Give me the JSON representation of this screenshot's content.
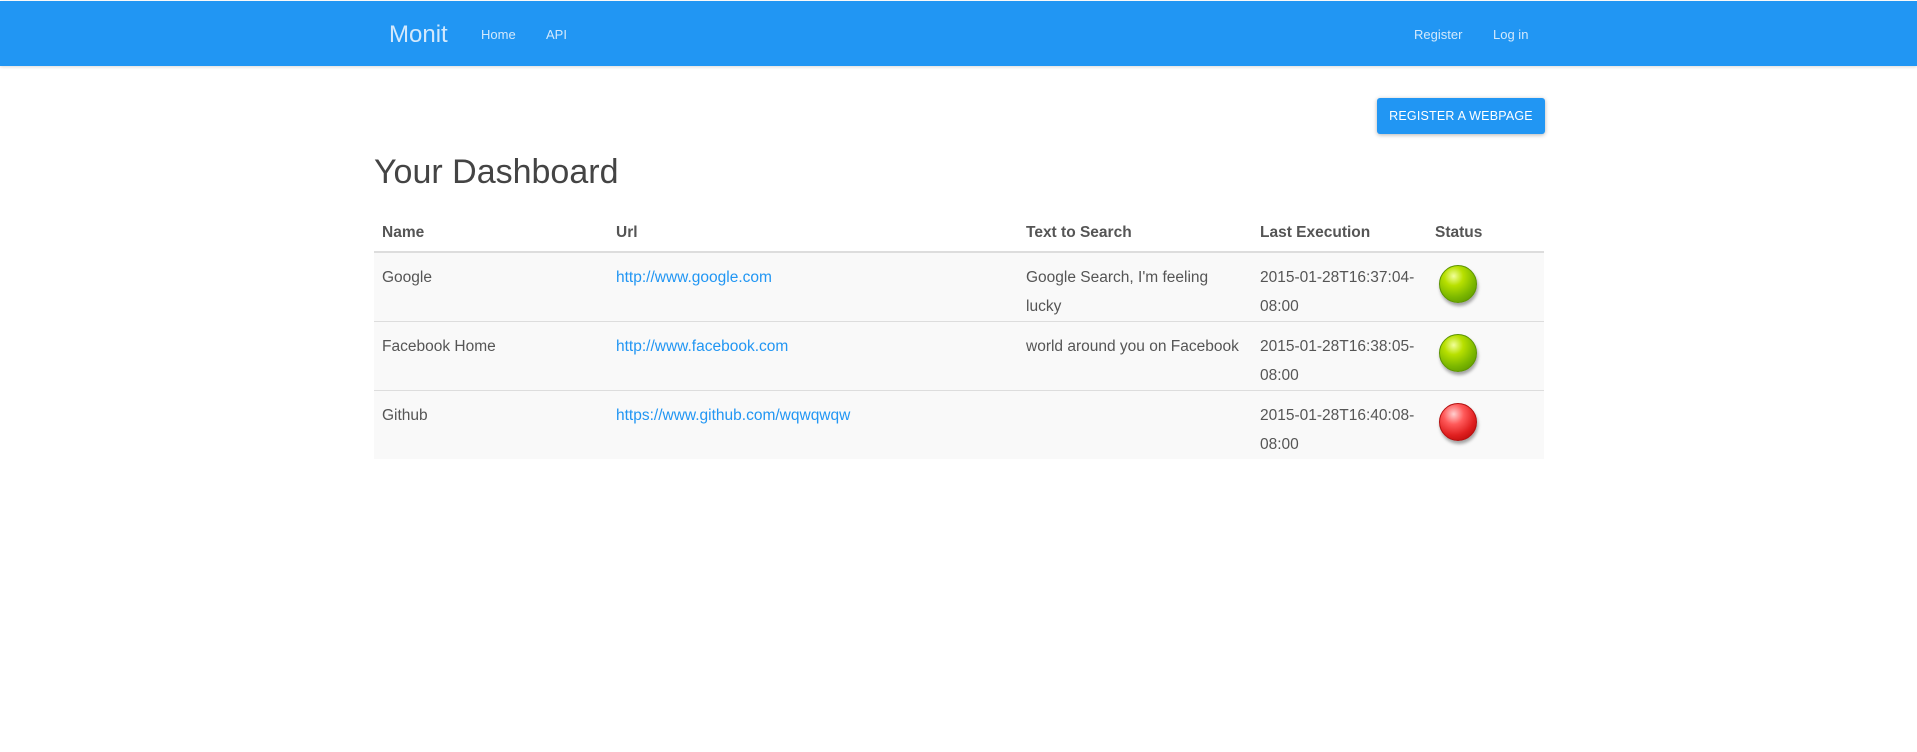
{
  "navbar": {
    "brand": "Monit",
    "links": [
      {
        "label": "Home"
      },
      {
        "label": "API"
      }
    ],
    "right_links": [
      {
        "label": "Register"
      },
      {
        "label": "Log in"
      }
    ],
    "background": "#2196f3"
  },
  "actions": {
    "register_label": "REGISTER A WEBPAGE"
  },
  "page": {
    "title": "Your Dashboard"
  },
  "table": {
    "headers": [
      "Name",
      "Url",
      "Text to Search",
      "Last Execution",
      "Status"
    ],
    "rows": [
      {
        "name": "Google",
        "url": "http://www.google.com",
        "text": "Google Search, I'm feeling lucky",
        "last": "2015-01-28T16:37:04-08:00",
        "status": "ok",
        "status_icon": "green-status-icon"
      },
      {
        "name": "Facebook Home",
        "url": "http://www.facebook.com",
        "text": "world around you on Facebook",
        "last": "2015-01-28T16:38:05-08:00",
        "status": "ok",
        "status_icon": "green-status-icon"
      },
      {
        "name": "Github",
        "url": "https://www.github.com/wqwqwqw",
        "text": "",
        "last": "2015-01-28T16:40:08-08:00",
        "status": "fail",
        "status_icon": "red-status-icon"
      }
    ]
  },
  "colors": {
    "accent": "#2196f3",
    "link": "#2196f3",
    "status_ok": "#8bc400",
    "status_fail": "#e02020"
  }
}
